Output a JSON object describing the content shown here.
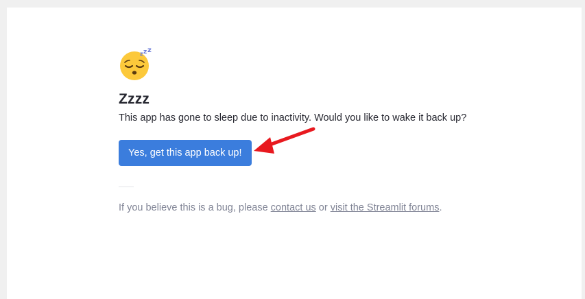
{
  "sleep_page": {
    "icon": "sleeping-face-emoji",
    "title": "Zzzz",
    "message": "This app has gone to sleep due to inactivity. Would you like to wake it back up?",
    "wake_button_label": "Yes, get this app back up!",
    "footer": {
      "prefix": "If you believe this is a bug, please ",
      "contact_link": "contact us",
      "middle": " or ",
      "forums_link": "visit the Streamlit forums",
      "suffix": "."
    }
  },
  "annotation": {
    "arrow_icon": "red-arrow-icon",
    "arrow_color": "#e8191f"
  },
  "colors": {
    "button": "#3b7ddd",
    "text": "#262730",
    "muted": "#808495"
  }
}
